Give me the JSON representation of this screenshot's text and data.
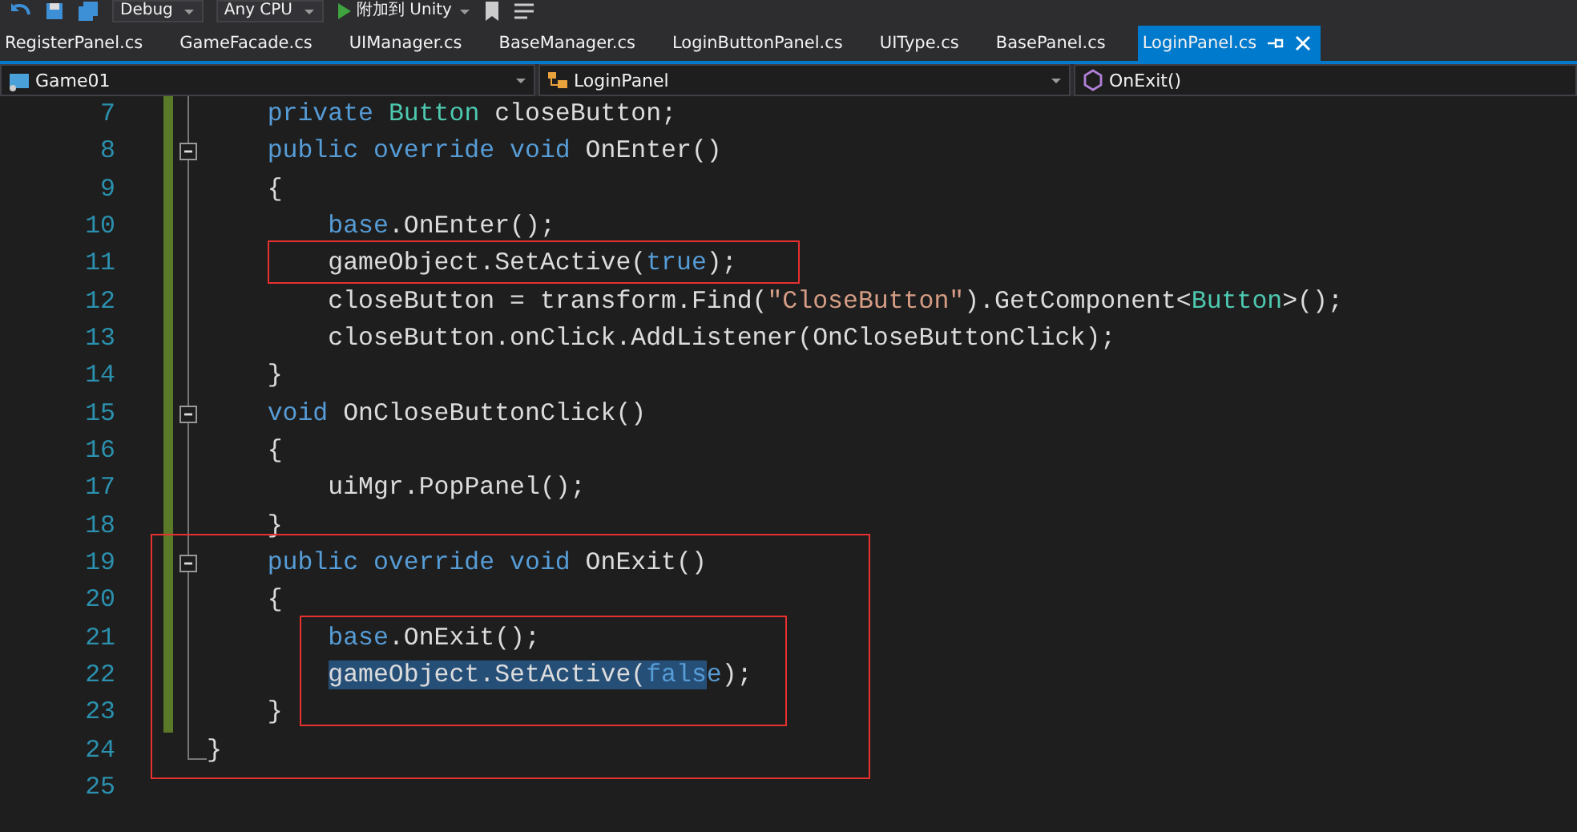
{
  "toolbar": {
    "items": [
      {
        "kind": "dropdown",
        "label": "Debug"
      },
      {
        "kind": "dropdown",
        "label": "Any CPU"
      },
      {
        "kind": "run",
        "label": "附加到 Unity"
      }
    ]
  },
  "tabs": [
    {
      "label": "RegisterPanel.cs",
      "selected": false
    },
    {
      "label": "GameFacade.cs",
      "selected": false
    },
    {
      "label": "UIManager.cs",
      "selected": false
    },
    {
      "label": "BaseManager.cs",
      "selected": false
    },
    {
      "label": "LoginButtonPanel.cs",
      "selected": false
    },
    {
      "label": "UIType.cs",
      "selected": false
    },
    {
      "label": "BasePanel.cs",
      "selected": false
    },
    {
      "label": "LoginPanel.cs",
      "selected": true
    }
  ],
  "navigation": {
    "project": "Game01",
    "class": "LoginPanel",
    "member": "OnExit()"
  },
  "code": [
    {
      "number": "7",
      "changed": true,
      "tokens": [
        {
          "text": "    private ",
          "kind": "keyword"
        },
        {
          "text": "Button",
          "kind": "type"
        },
        {
          "text": " closeButton;",
          "kind": "plain"
        }
      ]
    },
    {
      "number": "8",
      "changed": true,
      "fold_start": true,
      "tokens": [
        {
          "text": "    public override void",
          "kind": "keyword"
        },
        {
          "text": " OnEnter()",
          "kind": "plain"
        }
      ]
    },
    {
      "number": "9",
      "changed": true,
      "tokens": [
        {
          "text": "    {",
          "kind": "plain"
        }
      ]
    },
    {
      "number": "10",
      "changed": true,
      "tokens": [
        {
          "text": "        base",
          "kind": "keyword"
        },
        {
          "text": ".OnEnter();",
          "kind": "plain"
        }
      ]
    },
    {
      "kind": "box",
      "lines": [
        {
          "number": "11",
          "changed": true,
          "tokens": [
            {
              "text": "        gameObject.SetActive(",
              "kind": "plain"
            },
            {
              "text": "true",
              "kind": "keyword"
            },
            {
              "text": ");",
              "kind": "plain"
            }
          ]
        }
      ]
    },
    {
      "number": "12",
      "changed": true,
      "tokens": [
        {
          "text": "        closeButton = transform.Find(",
          "kind": "plain"
        },
        {
          "text": "\"CloseButton\"",
          "kind": "string"
        },
        {
          "text": ").GetComponent<",
          "kind": "plain"
        },
        {
          "text": "Button",
          "kind": "type"
        },
        {
          "text": ">();",
          "kind": "plain"
        }
      ]
    },
    {
      "number": "13",
      "changed": true,
      "tokens": [
        {
          "text": "        closeButton.onClick.AddListener(OnCloseButtonClick);",
          "kind": "plain"
        }
      ]
    },
    {
      "number": "14",
      "changed": true,
      "tokens": [
        {
          "text": "    }",
          "kind": "plain"
        }
      ]
    },
    {
      "number": "15",
      "changed": true,
      "fold_start": true,
      "tokens": [
        {
          "text": "    void",
          "kind": "keyword"
        },
        {
          "text": " OnCloseButtonClick()",
          "kind": "plain"
        }
      ]
    },
    {
      "number": "16",
      "changed": true,
      "tokens": [
        {
          "text": "    {",
          "kind": "plain"
        }
      ]
    },
    {
      "number": "17",
      "changed": true,
      "tokens": [
        {
          "text": "        uiMgr.PopPanel();",
          "kind": "plain"
        }
      ]
    },
    {
      "number": "18",
      "changed": true,
      "tokens": [
        {
          "text": "    }",
          "kind": "plain"
        }
      ]
    },
    {
      "kind": "box",
      "lines": [
        {
          "number": "19",
          "changed": true,
          "fold_start": true,
          "tokens": [
            {
              "text": "    public override void",
              "kind": "keyword"
            },
            {
              "text": " OnExit()",
              "kind": "plain"
            }
          ]
        },
        {
          "number": "20",
          "changed": true,
          "tokens": [
            {
              "text": "    {",
              "kind": "plain"
            }
          ]
        },
        {
          "kind": "box",
          "lines": [
            {
              "number": "21",
              "changed": true,
              "tokens": [
                {
                  "text": "        base",
                  "kind": "keyword"
                },
                {
                  "text": ".OnExit();",
                  "kind": "plain"
                }
              ]
            },
            {
              "number": "22",
              "changed": true,
              "tokens": [
                {
                  "text": "        gameObject.SetActive(",
                  "kind": "plain",
                  "selected": true
                },
                {
                  "text": "fals",
                  "kind": "keyword",
                  "selected": true
                },
                {
                  "text": "e",
                  "kind": "keyword",
                  "selected": false
                },
                {
                  "text": ");",
                  "kind": "plain",
                  "selected": false
                }
              ]
            }
          ]
        },
        {
          "number": "23",
          "changed": true,
          "tokens": [
            {
              "text": "    }",
              "kind": "plain"
            }
          ]
        },
        {
          "number": "24",
          "changed": false,
          "fold_end": true,
          "tokens": [
            {
              "text": "}",
              "kind": "plain"
            }
          ]
        }
      ]
    },
    {
      "number": "25",
      "changed": false
    }
  ]
}
